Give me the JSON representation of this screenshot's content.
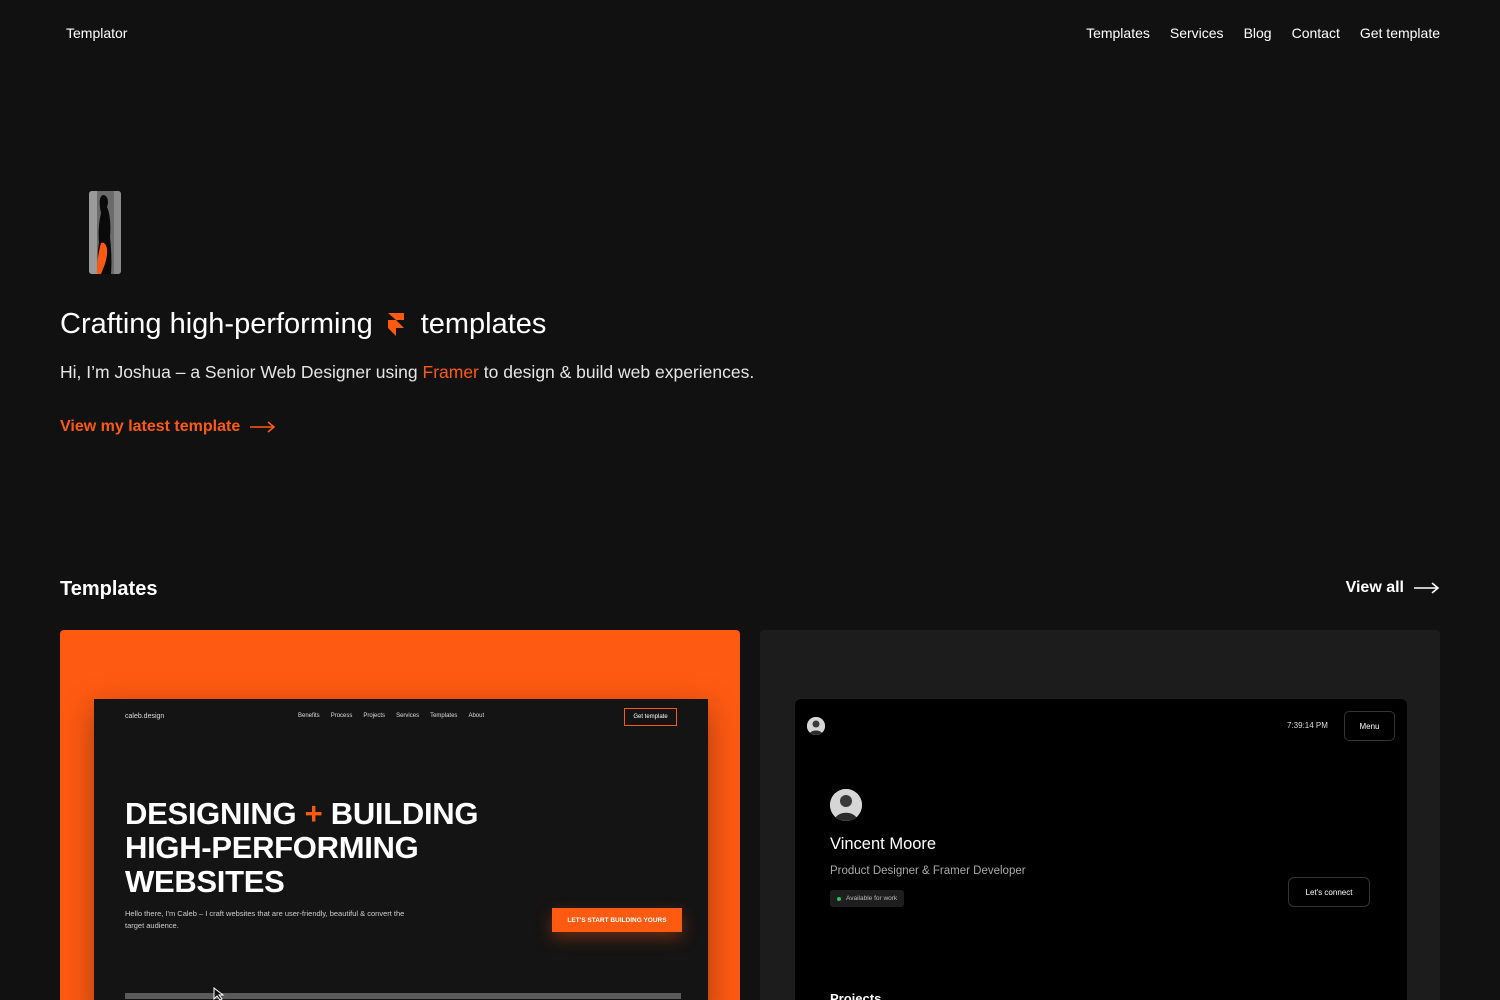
{
  "header": {
    "brand": "Templator",
    "nav": [
      "Templates",
      "Services",
      "Blog",
      "Contact",
      "Get template"
    ]
  },
  "hero": {
    "image_icon": "portrait-image",
    "headline_before": "Crafting high-performing",
    "headline_icon": "framer-logo-icon",
    "headline_after": "templates",
    "intro_before": "Hi, I’m Joshua – a Senior Web Designer using ",
    "intro_accent": "Framer",
    "intro_after": " to design & build web experiences.",
    "cta_label": "View my latest template",
    "cta_icon": "arrow-right-icon"
  },
  "templates_section": {
    "title": "Templates",
    "view_all_label": "View all",
    "view_all_icon": "arrow-right-icon"
  },
  "cards": [
    {
      "preview_logo": "caleb.design",
      "preview_nav": [
        "Benefits",
        "Process",
        "Projects",
        "Services",
        "Templates",
        "About"
      ],
      "preview_button": "Get template",
      "preview_heading_line1_a": "DESIGNING",
      "preview_heading_plus": "+",
      "preview_heading_line1_b": "BUILDING",
      "preview_heading_line2": "HIGH-PERFORMING",
      "preview_heading_line3": "WEBSITES",
      "preview_sub": "Hello there, I'm Caleb – I craft websites that are user-friendly, beautiful & convert the target audience.",
      "preview_cta": "LET'S START BUILDING YOURS"
    },
    {
      "preview_time": "7:39:14 PM",
      "preview_menu": "Menu",
      "preview_name": "Vincent Moore",
      "preview_role": "Product Designer & Framer Developer",
      "preview_badge": "Available for work",
      "preview_connect": "Let's connect",
      "preview_projects": "Projects"
    }
  ],
  "colors": {
    "background": "#111111",
    "accent": "#ff5a12",
    "card_dark": "#1c1c1c",
    "available_dot": "#22c55e"
  }
}
